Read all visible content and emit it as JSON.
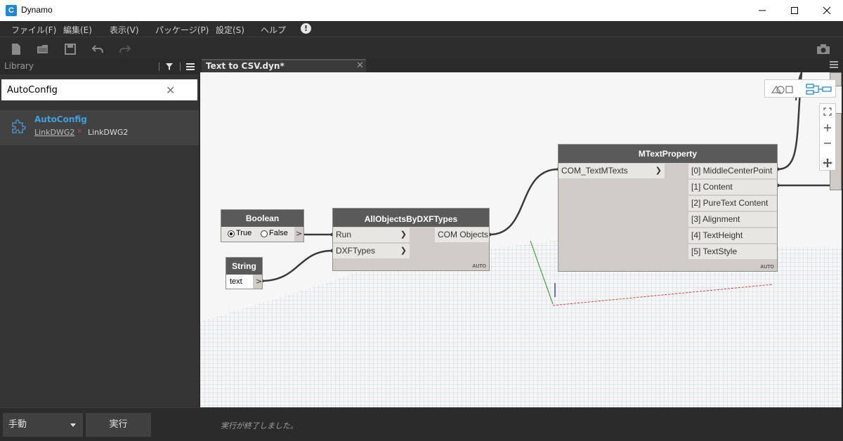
{
  "window": {
    "app_icon": "C",
    "title": "Dynamo"
  },
  "menu": {
    "items": [
      "ファイル(F)",
      "編集(E)",
      "表示(V)",
      "パッケージ(P)",
      "設定(S)",
      "ヘルプ"
    ],
    "notice_icon": "!"
  },
  "library": {
    "title": "Library",
    "search_value": "AutoConfig",
    "clear_icon": "✕",
    "result": {
      "name": "AutoConfig",
      "path": "LinkDWG2",
      "separator": "✕",
      "type": "LinkDWG2"
    }
  },
  "tab": {
    "label": "Text to CSV.dyn*",
    "close": "✕"
  },
  "nodes": {
    "boolean": {
      "title": "Boolean",
      "true_label": "True",
      "false_label": "False",
      "output": ">"
    },
    "string": {
      "title": "String",
      "value": "text",
      "output": ">"
    },
    "all_objects": {
      "title": "AllObjectsByDXFTypes",
      "inputs": [
        "Run",
        "DXFTypes"
      ],
      "output": "COM Objects",
      "auto": "AUTO"
    },
    "mtext": {
      "title": "MTextProperty",
      "input": "COM_TextMTexts",
      "outputs": [
        "[0] MiddleCenterPoint",
        "[1] Content",
        "[2] PureText Content",
        "[3] Alignment",
        "[4] TextHeight",
        "[5] TextStyle"
      ],
      "auto": "AUTO"
    },
    "arrow": "❯"
  },
  "bottom": {
    "run_mode": "手動",
    "run_button": "実行",
    "status": "実行が終了しました。"
  }
}
